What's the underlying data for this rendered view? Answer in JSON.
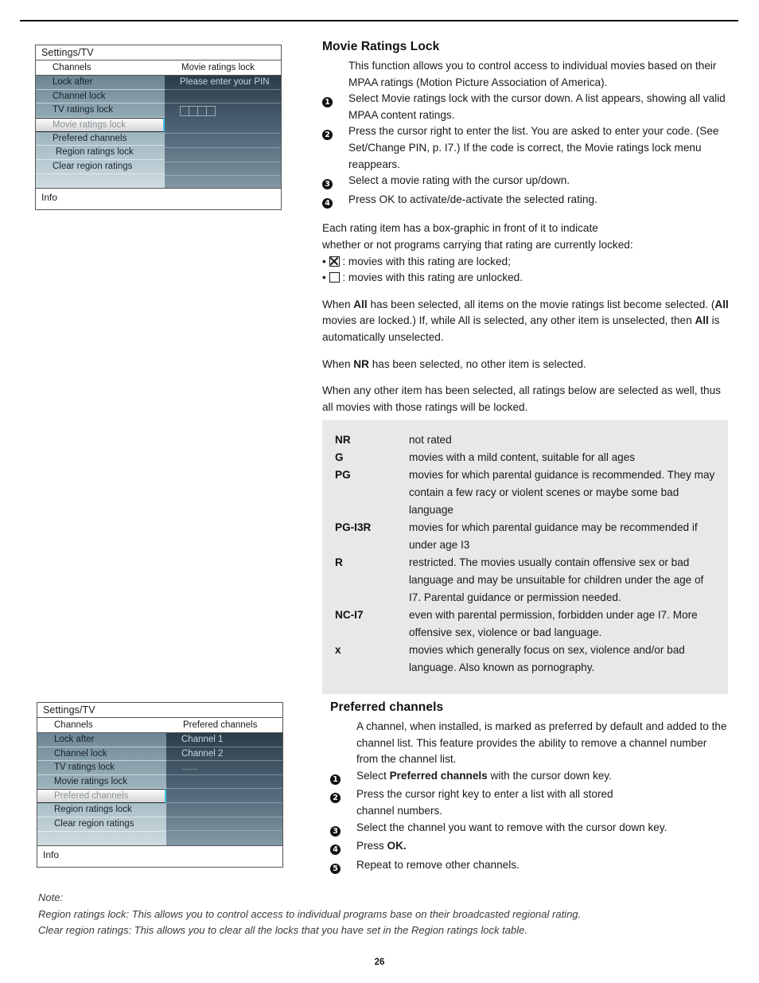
{
  "page": {
    "number": "26"
  },
  "tv_screenshot_1": {
    "title": "Settings/TV",
    "left_header": "Channels",
    "right_header": "Movie ratings lock",
    "menu_items": [
      {
        "label": "Lock after",
        "selected": false
      },
      {
        "label": "Channel lock",
        "selected": false
      },
      {
        "label": "TV ratings lock",
        "selected": false
      },
      {
        "label": "Movie ratings lock",
        "selected": true
      },
      {
        "label": "Prefered channels",
        "selected": false
      },
      {
        "label": "Region ratings lock",
        "selected": false
      },
      {
        "label": "Clear region ratings",
        "selected": false
      }
    ],
    "right_prompt": "Please enter your PIN",
    "pin_cells": 4,
    "info_label": "Info"
  },
  "tv_screenshot_2": {
    "title": "Settings/TV",
    "left_header": "Channels",
    "right_header": "Prefered channels",
    "menu_items": [
      {
        "label": "Lock after",
        "selected": false
      },
      {
        "label": "Channel lock",
        "selected": false
      },
      {
        "label": "TV ratings lock",
        "selected": false
      },
      {
        "label": "Movie ratings lock",
        "selected": false
      },
      {
        "label": "Prefered channels",
        "selected": true
      },
      {
        "label": "Region ratings lock",
        "selected": false
      },
      {
        "label": "Clear region ratings",
        "selected": false
      }
    ],
    "channel_list": [
      "Channel 1",
      "Channel 2",
      "........"
    ],
    "info_label": "Info"
  },
  "movie_ratings_lock": {
    "heading": "Movie Ratings Lock",
    "intro": "This function allows you to control access to individual movies based on their MPAA ratings (Motion Picture Association of America).",
    "steps": [
      {
        "num": "❶",
        "text_html": "Select Movie ratings lock with the cursor down. A list appears, showing all valid MPAA content ratings."
      },
      {
        "num": "❷",
        "text_html": "Press the cursor right to enter the list. You are asked to enter your code. (See Set/Change PIN, p. I7.) If the code is correct, the Movie ratings lock menu reappears."
      },
      {
        "num": "❸",
        "text_html": "Select a movie rating with the cursor up/down."
      },
      {
        "num": "❹",
        "text_html": "Press OK to activate/de-activate the selected rating."
      }
    ],
    "box_graphic_intro_line1": "Each rating item has a box-graphic in front of it to indicate",
    "box_graphic_intro_line2": "whether or not programs carrying that rating are currently locked:",
    "locked_bullet": ": movies with this rating are locked;",
    "unlocked_bullet": ": movies with this rating are unlocked.",
    "paragraph_all_1": "When ",
    "paragraph_all_all1": "All",
    "paragraph_all_2": " has been selected, all items on the movie ratings list become selected. (",
    "paragraph_all_all2": "All",
    "paragraph_all_3": " movies are locked.) If, while All is selected, any other item is unselected, then ",
    "paragraph_all_all3": "All",
    "paragraph_all_4": " is automatically unselected.",
    "paragraph_nr_1": "When ",
    "paragraph_nr_nr": "NR",
    "paragraph_nr_2": " has been selected, no other item is selected.",
    "paragraph_other": "When any other item has been selected, all ratings below are selected as well, thus all movies with those ratings will be locked."
  },
  "ratings_table": {
    "rows": [
      {
        "code": "NR",
        "desc": "not rated"
      },
      {
        "code": "G",
        "desc": "movies with a mild content, suitable for all ages"
      },
      {
        "code": "PG",
        "desc": "movies for which parental guidance is recommended. They may contain a few racy or violent scenes or maybe some bad language"
      },
      {
        "code": "PG-I3R",
        "desc": "movies for which parental guidance may be recommended if under age I3"
      },
      {
        "code": "R",
        "desc": "restricted. The movies usually contain offensive sex or bad language and may be unsuitable for children under the age of I7. Parental guidance or permission needed."
      },
      {
        "code": "NC-I7",
        "desc": "even with parental permission, forbidden under age I7. More offensive sex, violence or bad language."
      },
      {
        "code": "x",
        "desc": "movies which generally focus on sex, violence and/or bad language. Also known as pornography."
      }
    ]
  },
  "preferred_channels": {
    "heading": "Preferred channels",
    "intro": "A channel, when installed, is marked as preferred by default and added to the channel list. This feature provides the ability to remove a channel number from the channel list.",
    "steps": [
      {
        "num": "❶",
        "pre": "Select ",
        "bold": "Preferred channels",
        "post": " with the cursor down key."
      },
      {
        "num": "❷",
        "pre": "Press the cursor right key to enter a list with all stored channel numbers.",
        "bold": "",
        "post": ""
      },
      {
        "num": "❸",
        "pre": "Select the channel you want to remove with the cursor down key.",
        "bold": "",
        "post": ""
      },
      {
        "num": "❹",
        "pre": "Press ",
        "bold": "OK.",
        "post": ""
      },
      {
        "num": "❺",
        "pre": "Repeat to remove other channels.",
        "bold": "",
        "post": ""
      }
    ]
  },
  "note": {
    "label": "Note:",
    "line1": "Region ratings lock: This allows you to control access to individual programs base on their broadcasted regional rating.",
    "line2": "Clear region ratings: This allows you to clear all the locks that you have set in the Region ratings lock table."
  }
}
